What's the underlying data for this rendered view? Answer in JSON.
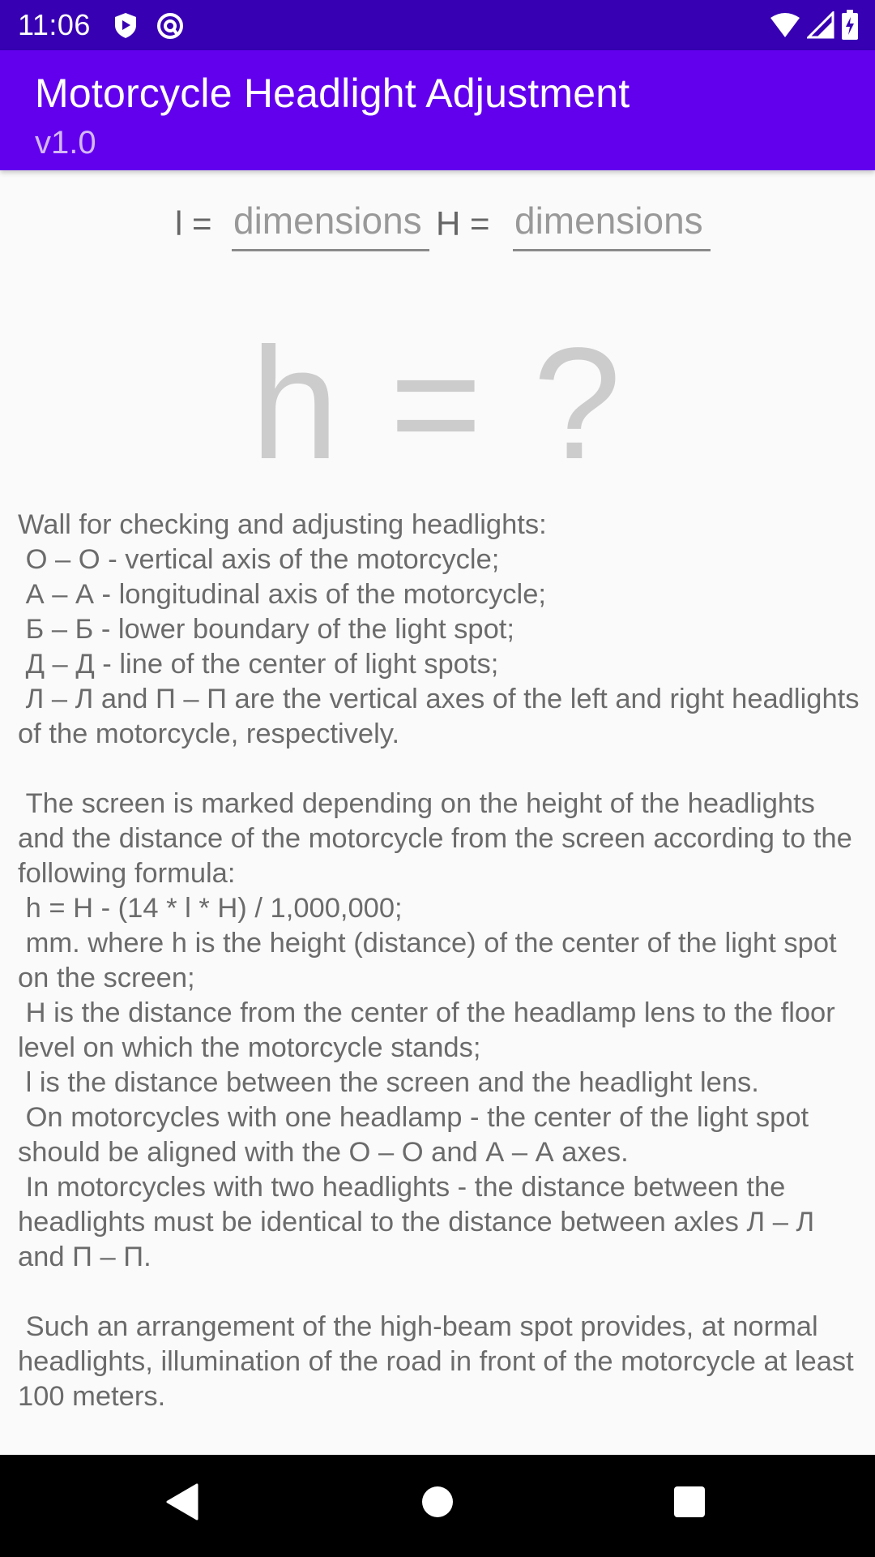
{
  "status_bar": {
    "time": "11:06",
    "left_icons": [
      "shield-play-icon",
      "at-circle-icon"
    ],
    "right_icons": [
      "wifi-icon",
      "cellular-signal-icon",
      "battery-charging-icon"
    ]
  },
  "app_bar": {
    "title": "Motorcycle Headlight Adjustment",
    "subtitle": "v1.0",
    "color": "#6200ee",
    "status_color": "#3700b3"
  },
  "inputs": {
    "l": {
      "label": "l =",
      "value": "",
      "placeholder": "dimensions"
    },
    "H": {
      "label": "H =",
      "value": "",
      "placeholder": "dimensions"
    }
  },
  "result": {
    "text": "h = ?"
  },
  "description": {
    "text": "Wall for checking and adjusting headlights:\n О – О - vertical axis of the motorcycle;\n А – А - longitudinal axis of the motorcycle;\n Б – Б - lower boundary of the light spot;\n Д – Д - line of the center of light spots;\n Л – Л and П – П are the vertical axes of the left and right headlights of the motorcycle, respectively.\n\n The screen is marked depending on the height of the headlights and the distance of the motorcycle from the screen according to the following formula:\n h = H - (14 * l * H) / 1,000,000;\n mm. where h is the height (distance) of the center of the light spot on the screen;\n H is the distance from the center of the headlamp lens to the floor level on which the motorcycle stands;\n l is the distance between the screen and the headlight lens.\n On motorcycles with one headlamp - the center of the light spot should be aligned with the О – О and А – А axes.\n In motorcycles with two headlights - the distance between the headlights must be identical to the distance between axles Л – Л and П – П.\n\n Such an arrangement of the high-beam spot provides, at normal headlights, illumination of the road in front of the motorcycle at least 100 meters."
  },
  "nav_bar": {
    "buttons": [
      "back-icon",
      "home-icon",
      "recents-icon"
    ]
  }
}
